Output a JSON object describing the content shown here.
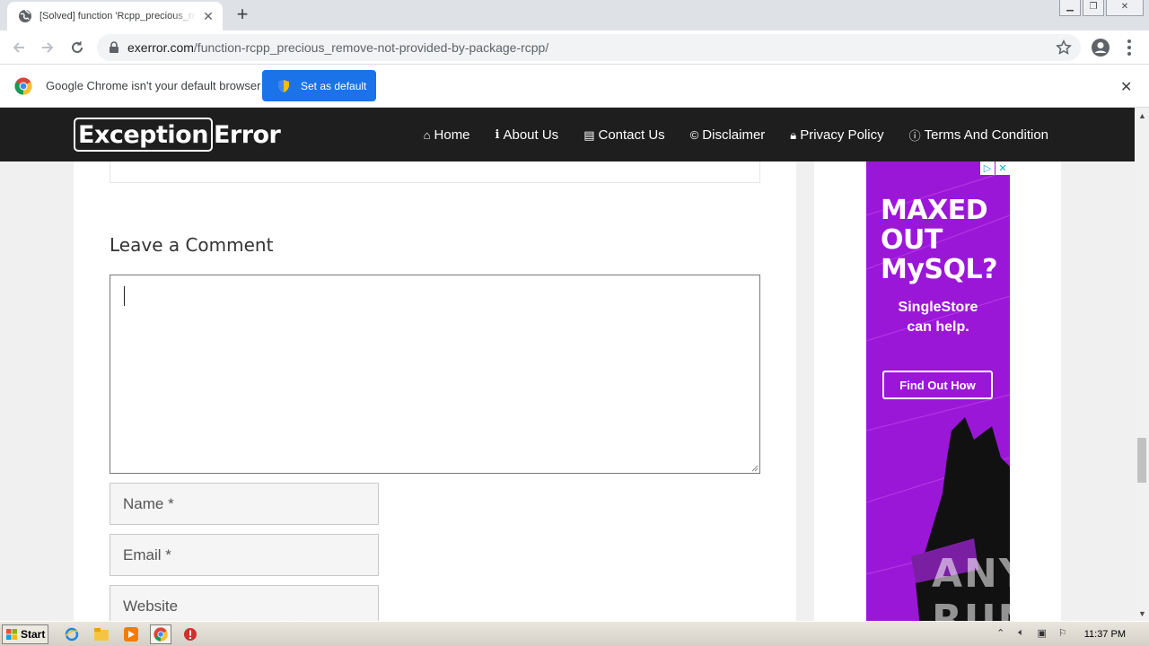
{
  "browser": {
    "tab_title": "[Solved] function 'Rcpp_precious_remove' not provided by package 'Rcpp'",
    "url_host": "exerror.com",
    "url_path": "/function-rcpp_precious_remove-not-provided-by-package-rcpp/"
  },
  "infobar": {
    "message": "Google Chrome isn't your default browser",
    "button_label": "Set as default"
  },
  "site": {
    "logo_boxed": "Exception",
    "logo_rest": "Error",
    "nav": [
      {
        "label": "Home",
        "icon": "home-icon"
      },
      {
        "label": "About Us",
        "icon": "info-icon"
      },
      {
        "label": "Contact Us",
        "icon": "address-card-icon"
      },
      {
        "label": "Disclaimer",
        "icon": "copyright-icon"
      },
      {
        "label": "Privacy Policy",
        "icon": "lock-icon"
      },
      {
        "label": "Terms And Condition",
        "icon": "info-circle-icon"
      }
    ]
  },
  "comment_form": {
    "heading": "Leave a Comment",
    "name_placeholder": "Name *",
    "email_placeholder": "Email *",
    "website_placeholder": "Website"
  },
  "ad": {
    "headline": "MAXED OUT MySQL?",
    "sub_line1": "SingleStore",
    "sub_line2": "can help.",
    "cta": "Find Out How",
    "colors": {
      "background": "#9b17d8",
      "text": "#ffffff"
    }
  },
  "watermark": "ANY RUN",
  "taskbar": {
    "start_label": "Start",
    "clock": "11:37 PM"
  },
  "colors": {
    "header_bg": "#1e1e1e",
    "infobar_button": "#1a73e8",
    "page_bg": "#f0f0f0"
  }
}
